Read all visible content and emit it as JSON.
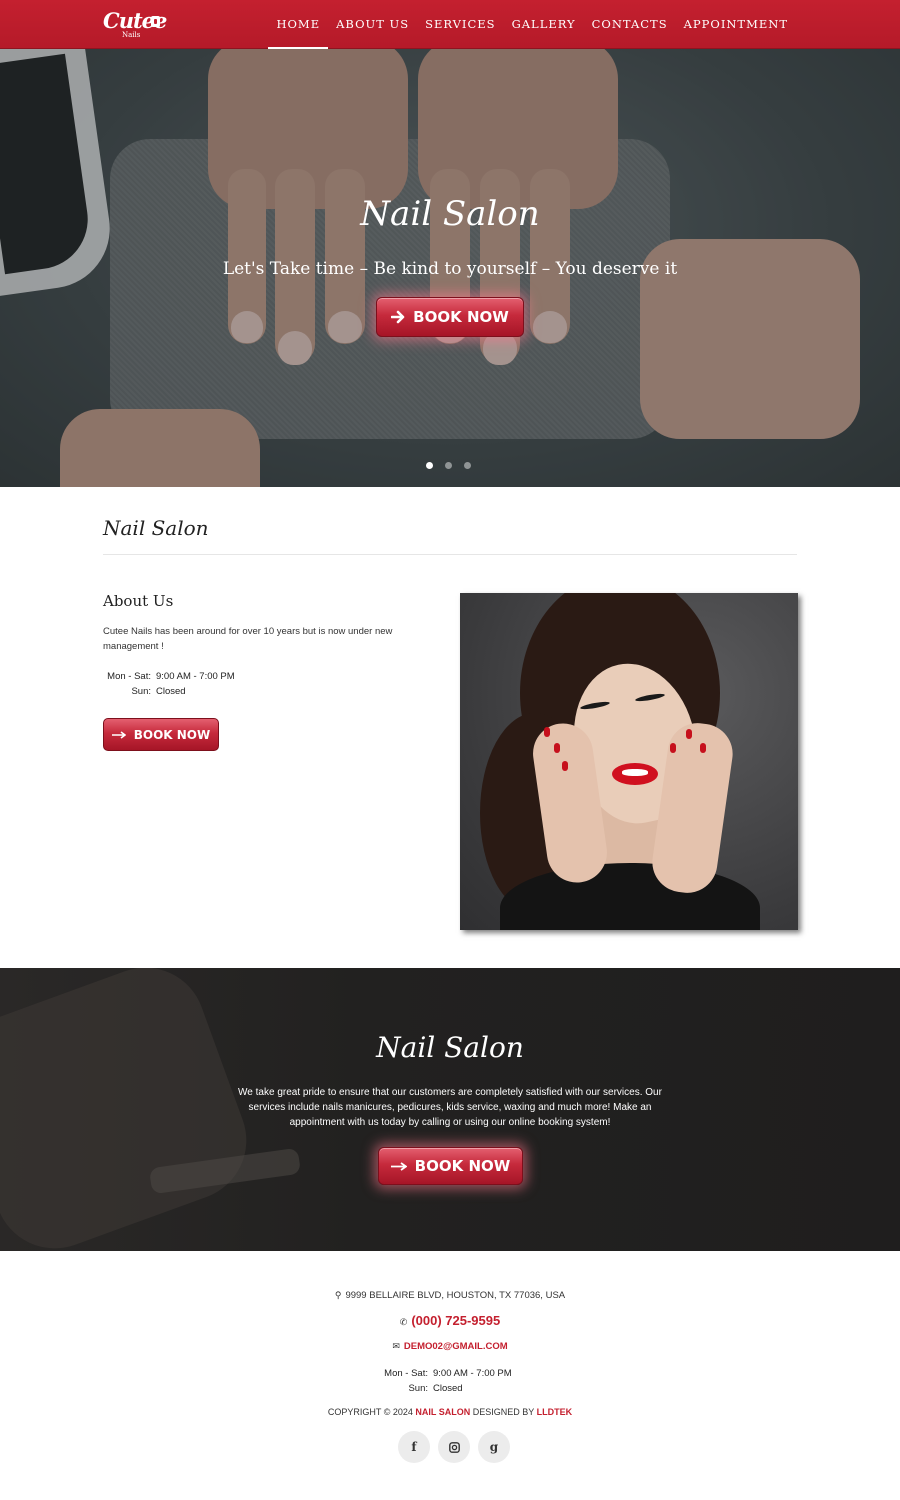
{
  "brand": {
    "logo_text": "Cutee",
    "logo_sub": "Nails"
  },
  "nav": {
    "items": [
      {
        "label": "HOME",
        "active": true
      },
      {
        "label": "ABOUT US"
      },
      {
        "label": "SERVICES"
      },
      {
        "label": "GALLERY"
      },
      {
        "label": "CONTACTS"
      },
      {
        "label": "APPOINTMENT"
      }
    ]
  },
  "hero": {
    "title": "Nail Salon",
    "subtitle": "Let's Take time – Be kind to yourself – You deserve it",
    "button_label": "BOOK NOW",
    "button_icon": "arrow-right-icon",
    "slides_count": 3,
    "active_slide": 1
  },
  "section": {
    "title": "Nail Salon",
    "about_heading": "About Us",
    "about_text": "Cutee Nails has been around for over 10 years but is now under new management !",
    "hours": [
      {
        "day": "Mon - Sat:",
        "time": "9:00 AM - 7:00 PM"
      },
      {
        "day": "Sun:",
        "time": "Closed"
      }
    ],
    "button_label": "BOOK NOW",
    "button_icon": "long-arrow-right-icon"
  },
  "promo": {
    "title": "Nail Salon",
    "text": "We take great pride to ensure that our customers are completely satisfied with our services. Our services include nails manicures, pedicures, kids service, waxing and much more! Make an appointment with us today by calling or using our online booking system!",
    "button_label": "BOOK NOW"
  },
  "footer": {
    "address": "9999 BELLAIRE BLVD, HOUSTON, TX 77036, USA",
    "phone": "(000) 725-9595",
    "email": "DEMO02@GMAIL.COM",
    "hours": [
      {
        "day": "Mon - Sat:",
        "time": "9:00 AM - 7:00 PM"
      },
      {
        "day": "Sun:",
        "time": "Closed"
      }
    ],
    "copyright_prefix": "COPYRIGHT © 2024",
    "copyright_brand": "NAIL SALON",
    "copyright_mid": "DESIGNED BY",
    "copyright_designer": "LLDTEK",
    "social": [
      {
        "name": "facebook-icon",
        "glyph": "f"
      },
      {
        "name": "instagram-icon",
        "glyph": "◙"
      },
      {
        "name": "google-icon",
        "glyph": "g"
      }
    ]
  },
  "colors": {
    "brand_red": "#c4202f",
    "dark_bg": "#222120"
  }
}
